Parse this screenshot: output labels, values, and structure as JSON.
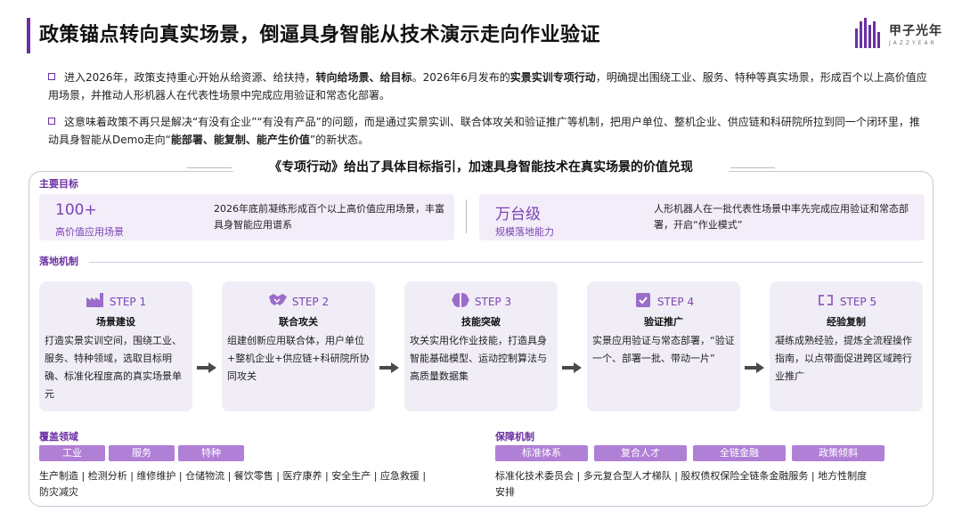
{
  "header": {
    "title": "政策锚点转向真实场景，倒逼具身智能从技术演示走向作业验证",
    "logo_text": "甲子光年",
    "logo_sub": "JAZZYEAR"
  },
  "bullets": [
    {
      "parts": [
        {
          "t": "进入2026年，政策支持重心开始从给资源、给扶持，",
          "b": false
        },
        {
          "t": "转向给场景、给目标",
          "b": true
        },
        {
          "t": "。2026年6月发布的",
          "b": false
        },
        {
          "t": "实景实训专项行动",
          "b": true
        },
        {
          "t": "，明确提出围绕工业、服务、特种等真实场景，形成百个以上高价值应用场景，并推动人形机器人在代表性场景中完成应用验证和常态化部署。",
          "b": false
        }
      ]
    },
    {
      "parts": [
        {
          "t": "这意味着政策不再只是解决“有没有企业”“有没有产品”的问题，而是通过实景实训、联合体攻关和验证推广等机制，把用户单位、整机企业、供应链和科研院所拉到同一个闭环里，推动具身智能从Demo走向“",
          "b": false
        },
        {
          "t": "能部署、能复制、能产生价值",
          "b": true
        },
        {
          "t": "”的新状态。",
          "b": false
        }
      ]
    }
  ],
  "subtitle": "《专项行动》给出了具体目标指引，加速具身智能技术在真实场景的价值兑现",
  "goals": {
    "label": "主要目标",
    "items": [
      {
        "value": "100+",
        "caption": "高价值应用场景",
        "desc": "2026年底前凝练形成百个以上高价值应用场景，丰富具身智能应用谱系"
      },
      {
        "value": "万台级",
        "caption": "规模落地能力",
        "desc": "人形机器人在一批代表性场景中率先完成应用验证和常态部署，开启“作业模式”"
      }
    ]
  },
  "mechanism": {
    "label": "落地机制",
    "steps": [
      {
        "step": "STEP 1",
        "icon": "factory-icon",
        "name": "场景建设",
        "desc": "打造实景实训空间，围绕工业、服务、特种领域，选取目标明确、标准化程度高的真实场景单元"
      },
      {
        "step": "STEP 2",
        "icon": "handshake-icon",
        "name": "联合攻关",
        "desc": "组建创新应用联合体，用户单位+整机企业+供应链+科研院所协同攻关"
      },
      {
        "step": "STEP 3",
        "icon": "brain-icon",
        "name": "技能突破",
        "desc": "攻关实用化作业技能，打造具身智能基础模型、运动控制算法与高质量数据集"
      },
      {
        "step": "STEP 4",
        "icon": "check-icon",
        "name": "验证推广",
        "desc": "实景应用验证与常态部署，“验证一个、部署一批、带动一片”"
      },
      {
        "step": "STEP 5",
        "icon": "replicate-icon",
        "name": "经验复制",
        "desc": "凝练成熟经验，提炼全流程操作指南，以点带面促进跨区域跨行业推广"
      }
    ]
  },
  "coverage": {
    "label": "覆盖领域",
    "tags": [
      "工业",
      "服务",
      "特种"
    ],
    "text": "生产制造 | 检测分析 | 维修维护 | 仓储物流 | 餐饮零售 | 医疗康养 | 安全生产 | 应急救援 | 防灾减灾"
  },
  "support": {
    "label": "保障机制",
    "tags": [
      "标准体系",
      "复合人才",
      "全链金融",
      "政策倾斜"
    ],
    "text": "标准化技术委员会 | 多元复合型人才梯队 | 股权债权保险全链条金融服务 | 地方性制度安排"
  },
  "colors": {
    "accent": "#6b2fa3",
    "tag": "#b07fd6",
    "step_bg": "#f1edf6",
    "goal_bg": "#f3edf9"
  }
}
